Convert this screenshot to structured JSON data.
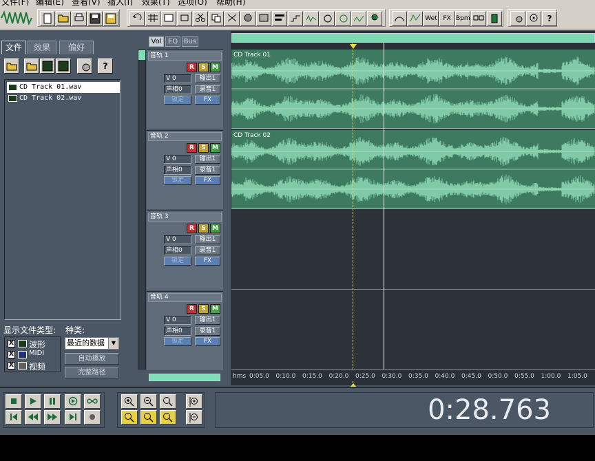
{
  "menu": [
    "文件(F)",
    "编辑(E)",
    "查看(V)",
    "插入(I)",
    "效果(T)",
    "选项(O)",
    "帮助(H)"
  ],
  "left_panel": {
    "tabs": [
      "文件",
      "效果",
      "偏好"
    ],
    "files": [
      "CD Track 01.wav",
      "CD Track 02.wav"
    ],
    "show_types_label": "显示文件类型:",
    "category_label": "种类:",
    "types": [
      "波形",
      "MIDI",
      "视频"
    ],
    "sort_select": "最近的数据",
    "autoplay_button": "自动播放",
    "fullpath_button": "完整路径"
  },
  "mixer": {
    "tabs": [
      "Vol",
      "EQ",
      "Bus"
    ],
    "tracks": [
      {
        "name": "音轨 1",
        "vol": "V 0",
        "pan": "声相0",
        "out": "输出1",
        "rec": "录音1",
        "lock": "锁定",
        "fx": "FX"
      },
      {
        "name": "音轨 2",
        "vol": "V 0",
        "pan": "声相0",
        "out": "输出1",
        "rec": "录音1",
        "lock": "锁定",
        "fx": "FX"
      },
      {
        "name": "音轨 3",
        "vol": "V 0",
        "pan": "声相0",
        "out": "输出1",
        "rec": "录音1",
        "lock": "锁定",
        "fx": "FX"
      },
      {
        "name": "音轨 4",
        "vol": "V 0",
        "pan": "声相0",
        "out": "输出1",
        "rec": "录音1",
        "lock": "锁定",
        "fx": "FX"
      }
    ],
    "rsm": [
      "R",
      "S",
      "M"
    ]
  },
  "waves": {
    "clip1": "CD Track 01",
    "clip2": "CD Track 02",
    "ticks": [
      "hms",
      "0:05.0",
      "0:10.0",
      "0:15.0",
      "0:20.0",
      "0:25.0",
      "0:30.0",
      "0:35.0",
      "0:40.0",
      "0:45.0",
      "0:50.0",
      "0:55.0",
      "1:00.0",
      "1:05.0"
    ]
  },
  "toolbar": {
    "wet_label": "Wet",
    "fx_label": "FX",
    "bpm_label": "Bpm",
    "help": "?"
  },
  "transport": {
    "time": "0:28.763"
  },
  "colors": {
    "wave_bg": "#3d7a60",
    "wave_fg": "#8ed8b4",
    "panel": "#4b5765"
  }
}
